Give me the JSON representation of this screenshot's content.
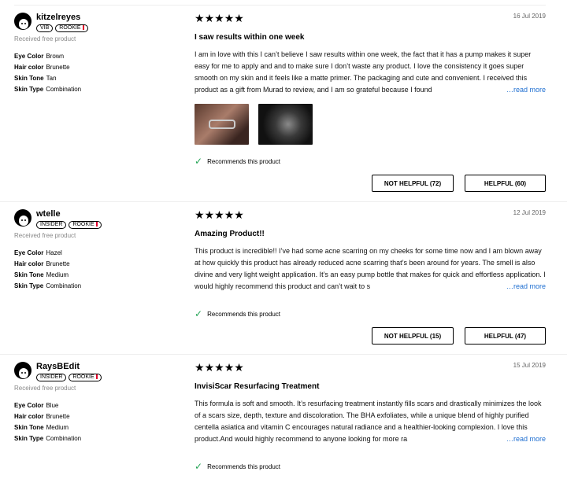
{
  "reviews": [
    {
      "username": "kitzelreyes",
      "badges": [
        "VIB",
        "ROOKIE"
      ],
      "free_product": "Received free product",
      "attributes": [
        {
          "key": "Eye Color",
          "value": "Brown"
        },
        {
          "key": "Hair color",
          "value": "Brunette"
        },
        {
          "key": "Skin Tone",
          "value": "Tan"
        },
        {
          "key": "Skin Type",
          "value": "Combination"
        }
      ],
      "rating": 5,
      "date": "16 Jul 2019",
      "title": "I saw results within one week",
      "body": "I am in love with this I can’t believe I saw results within one week, the fact that it has a pump makes it super easy for me to apply and and to make sure I don’t waste any product. I love the consistency it goes super smooth on my skin and it feels like a matte primer. The packaging and cute and convenient. I received this product as a gift from Murad to review, and I am so grateful because I found",
      "more": "…read more",
      "recommends": "Recommends this product",
      "not_helpful": "NOT HELPFUL (72)",
      "helpful": "HELPFUL (60)"
    },
    {
      "username": "wtelle",
      "badges": [
        "INSIDER",
        "ROOKIE"
      ],
      "free_product": "Received free product",
      "attributes": [
        {
          "key": "Eye Color",
          "value": "Hazel"
        },
        {
          "key": "Hair color",
          "value": "Brunette"
        },
        {
          "key": "Skin Tone",
          "value": "Medium"
        },
        {
          "key": "Skin Type",
          "value": "Combination"
        }
      ],
      "rating": 5,
      "date": "12 Jul 2019",
      "title": "Amazing Product!!",
      "body": "This product is incredible!! I’ve had some acne scarring on my cheeks for some time now and I am blown away at how quickly this product has already reduced acne scarring that’s been around for years. The smell is also divine and very light weight application. It’s an easy pump bottle that makes for quick and effortless application. I would highly recommend this product and can’t wait to s",
      "more": "…read more",
      "recommends": "Recommends this product",
      "not_helpful": "NOT HELPFUL (15)",
      "helpful": "HELPFUL (47)"
    },
    {
      "username": "RaysBEdit",
      "badges": [
        "INSIDER",
        "ROOKIE"
      ],
      "free_product": "Received free product",
      "attributes": [
        {
          "key": "Eye Color",
          "value": "Blue"
        },
        {
          "key": "Hair color",
          "value": "Brunette"
        },
        {
          "key": "Skin Tone",
          "value": "Medium"
        },
        {
          "key": "Skin Type",
          "value": "Combination"
        }
      ],
      "rating": 5,
      "date": "15 Jul 2019",
      "title": "InvisiScar Resurfacing Treatment",
      "body": "This formula is soft and smooth. It’s resurfacing treatment instantly fills scars and drastically minimizes the look of a scars size, depth, texture and discoloration. The BHA exfoliates, while a unique blend of highly purified centella asiatica and vitamin C encourages natural radiance and a healthier-looking complexion. I love this product.And would highly recommend to anyone looking for more ra",
      "more": "…read more",
      "recommends": "Recommends this product"
    }
  ],
  "colors": {
    "accent_link": "#1f6fd1",
    "check": "#23a455",
    "rookie": "#e0002b"
  }
}
